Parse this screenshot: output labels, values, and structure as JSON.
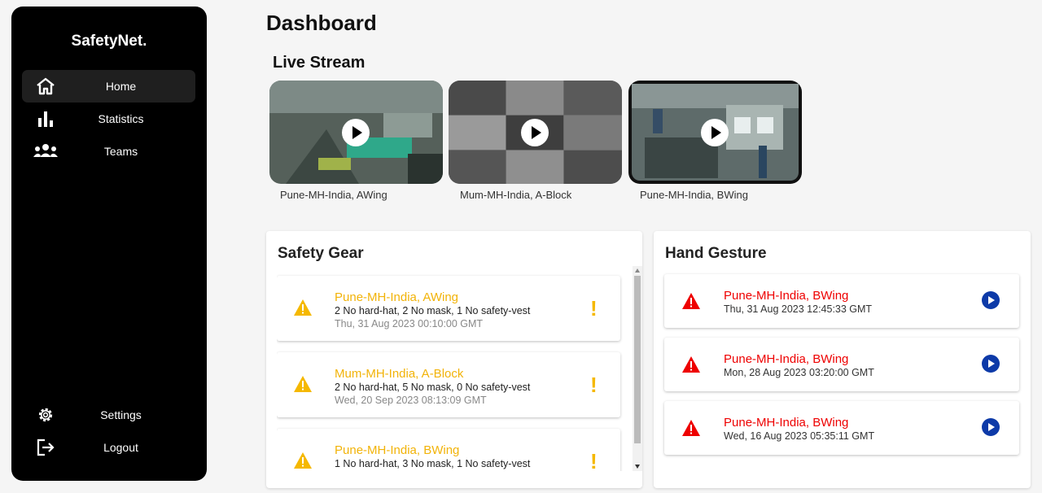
{
  "sidebar": {
    "brand": "SafetyNet.",
    "nav": [
      {
        "label": "Home",
        "icon": "home-icon",
        "active": true
      },
      {
        "label": "Statistics",
        "icon": "bar-chart-icon"
      },
      {
        "label": "Teams",
        "icon": "teams-icon"
      }
    ],
    "bottom": [
      {
        "label": "Settings",
        "icon": "gear-icon"
      },
      {
        "label": "Logout",
        "icon": "logout-icon"
      }
    ]
  },
  "page": {
    "title": "Dashboard"
  },
  "live_stream": {
    "title": "Live Stream",
    "streams": [
      {
        "label": "Pune-MH-India, AWing"
      },
      {
        "label": "Mum-MH-India, A-Block"
      },
      {
        "label": "Pune-MH-India, BWing"
      }
    ]
  },
  "safety_gear": {
    "title": "Safety Gear",
    "items": [
      {
        "location": "Pune-MH-India, AWing",
        "details": "2 No hard-hat, 2 No mask, 1 No safety-vest",
        "time": "Thu, 31 Aug 2023 00:10:00 GMT"
      },
      {
        "location": "Mum-MH-India, A-Block",
        "details": "2 No hard-hat, 5 No mask, 0 No safety-vest",
        "time": "Wed, 20 Sep 2023 08:13:09 GMT"
      },
      {
        "location": "Pune-MH-India, BWing",
        "details": "1 No hard-hat, 3 No mask, 1 No safety-vest",
        "time": ""
      }
    ]
  },
  "hand_gesture": {
    "title": "Hand Gesture",
    "items": [
      {
        "location": "Pune-MH-India, BWing",
        "time": "Thu, 31 Aug 2023 12:45:33 GMT"
      },
      {
        "location": "Pune-MH-India, BWing",
        "time": "Mon, 28 Aug 2023 03:20:00 GMT"
      },
      {
        "location": "Pune-MH-India, BWing",
        "time": "Wed, 16 Aug 2023 05:35:11 GMT"
      }
    ]
  },
  "colors": {
    "sidebar_bg": "#000000",
    "warning_yellow": "#f5b800",
    "alert_red": "#e00000",
    "play_blue": "#0d3aa8"
  }
}
